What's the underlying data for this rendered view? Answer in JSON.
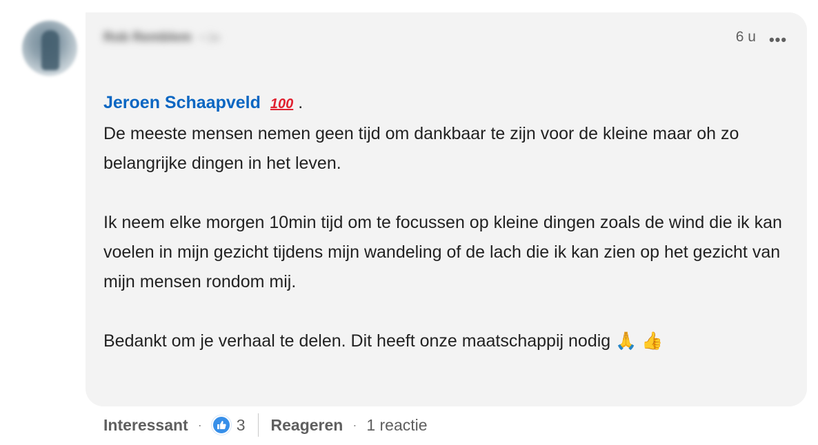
{
  "comment": {
    "author_name": "Rob Remblem",
    "author_meta": "• 2e",
    "timestamp": "6 u",
    "more_label": "•••",
    "mention": "Jeroen Schaapveld",
    "mention_emoji": "100",
    "mention_suffix": ".",
    "paragraphs": [
      "De meeste mensen nemen geen tijd om dankbaar te zijn voor de kleine maar oh zo belangrijke dingen in het leven.",
      "Ik  neem elke morgen 10min tijd om te focussen op kleine dingen zoals de wind die ik kan voelen in mijn gezicht tijdens mijn wandeling of de lach die ik kan zien op het gezicht van mijn mensen rondom mij.",
      "Bedankt om je verhaal te delen. Dit heeft onze maatschappij nodig"
    ],
    "closing_emojis": [
      "🙏",
      "👍"
    ]
  },
  "actions": {
    "like_label": "Interessant",
    "separator": "·",
    "reaction_icon": "like-reaction-icon",
    "reaction_count": "3",
    "reply_label": "Reageren",
    "reply_count": "1 reactie"
  },
  "colors": {
    "mention": "#0a66c2",
    "bubble": "#f3f3f3",
    "like_blue": "#378fe9"
  }
}
